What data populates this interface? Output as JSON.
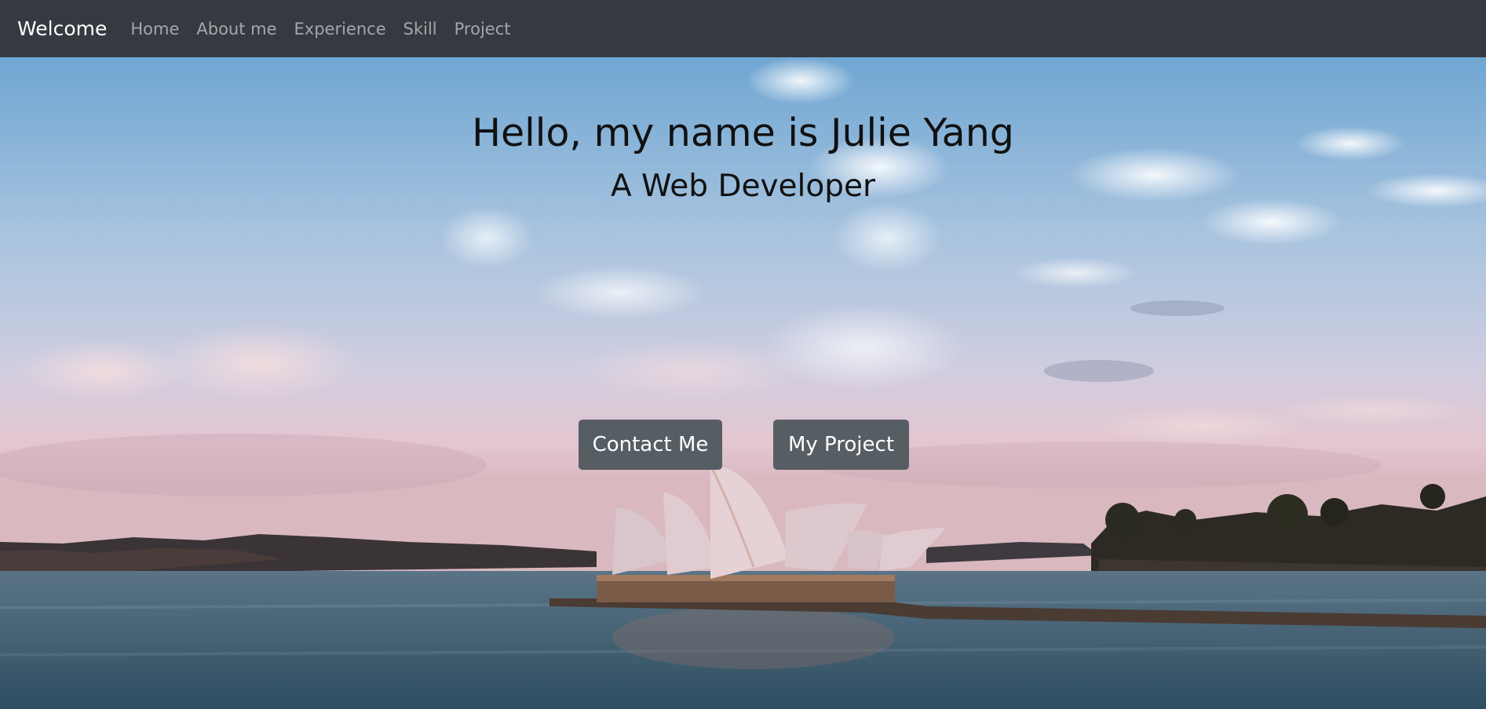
{
  "navbar": {
    "brand": "Welcome",
    "links": [
      "Home",
      "About me",
      "Experience",
      "Skill",
      "Project"
    ]
  },
  "hero": {
    "title": "Hello, my name is Julie Yang",
    "subtitle": "A Web Developer",
    "buttons": {
      "contact": "Contact Me",
      "project": "My Project"
    }
  },
  "colors": {
    "navbar_bg": "#343a40",
    "button_bg": "#565e64",
    "sky_top": "#7fb0d6",
    "sky_mid": "#c6cde3",
    "sky_horizon": "#e6c0c3",
    "water": "#3d5f72"
  }
}
